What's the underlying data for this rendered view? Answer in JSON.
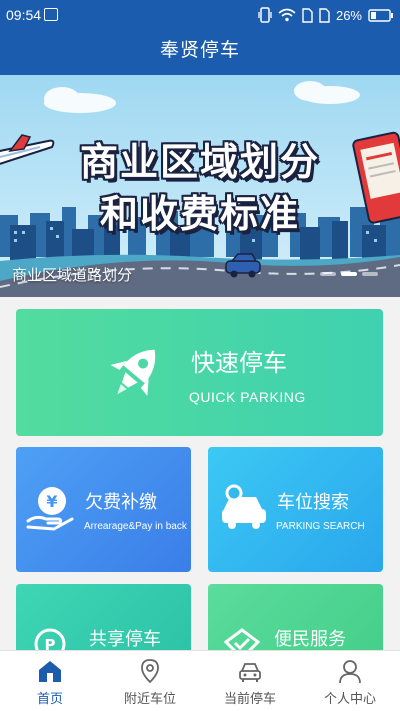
{
  "status_bar": {
    "time": "09:54",
    "battery": "26%"
  },
  "header": {
    "title": "奉贤停车"
  },
  "banner": {
    "headline_line1": "商业区域划分",
    "headline_line2": "和收费标准",
    "caption": "商业区域道路划分",
    "slides": 3,
    "active_slide": 2
  },
  "cards": {
    "quick": {
      "title": "快速停车",
      "subtitle": "QUICK PARKING",
      "icon": "rocket-icon"
    },
    "arrears": {
      "title": "欠费补缴",
      "subtitle": "Arrearage&Pay in back",
      "icon": "yen-hand-icon"
    },
    "search": {
      "title": "车位搜索",
      "subtitle": "PARKING SEARCH",
      "icon": "car-search-icon"
    },
    "share": {
      "title": "共享停车",
      "icon": "parking-share-icon"
    },
    "service": {
      "title": "便民服务",
      "icon": "service-icon"
    }
  },
  "bottom_nav": [
    {
      "label": "首页",
      "icon": "home-icon",
      "active": true
    },
    {
      "label": "附近车位",
      "icon": "location-pin-icon",
      "active": false
    },
    {
      "label": "当前停车",
      "icon": "car-icon",
      "active": false
    },
    {
      "label": "个人中心",
      "icon": "user-icon",
      "active": false
    }
  ],
  "colors": {
    "brand_blue": "#1b5cae",
    "quick_green": "#4bd8a6",
    "arrears_blue": "#4596f0",
    "search_cyan": "#33b8f0"
  }
}
